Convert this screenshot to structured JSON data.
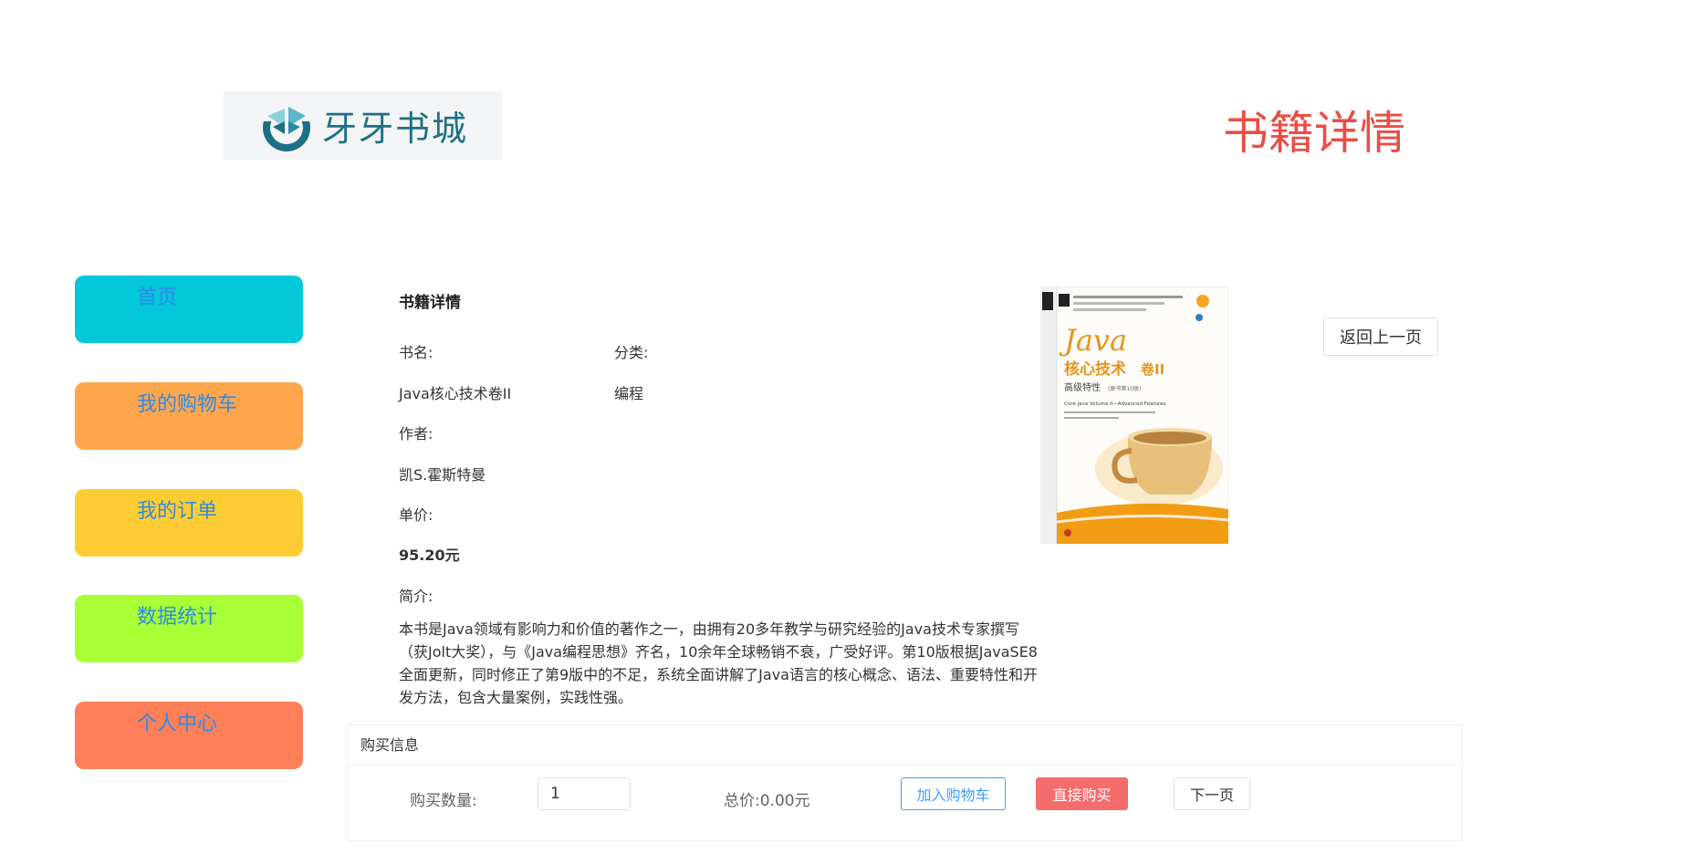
{
  "brand": {
    "logo_text": "牙牙书城"
  },
  "header": {
    "title": "书籍详情"
  },
  "nav": {
    "items": [
      {
        "label": "首页",
        "color": "#04c7da"
      },
      {
        "label": "我的购物车",
        "color": "#ffa64d"
      },
      {
        "label": "我的订单",
        "color": "#ffcc33"
      },
      {
        "label": "数据统计",
        "color": "#a8ff33"
      },
      {
        "label": "个人中心",
        "color": "#ff7f59"
      }
    ]
  },
  "book": {
    "section_title": "书籍详情",
    "name_label": "书名:",
    "name": "Java核心技术卷II",
    "category_label": "分类:",
    "category": "编程",
    "author_label": "作者:",
    "author": "凯S.霍斯特曼",
    "price_label": "单价:",
    "price": "95.20元",
    "intro_label": "简介:",
    "intro": "本书是Java领域有影响力和价值的著作之一，由拥有20多年教学与研究经验的Java技术专家撰写（获Jolt大奖），与《Java编程思想》齐名，10余年全球畅销不衰，广受好评。第10版根据JavaSE8全面更新，同时修正了第9版中的不足，系统全面讲解了Java语言的核心概念、语法、重要特性和开发方法，包含大量案例，实践性强。"
  },
  "cover": {
    "title_java": "Java",
    "title_cn": "核心技术",
    "volume": "卷II",
    "subtitle": "高级特性",
    "edition": "(原书第10版)",
    "english": "Core Java Volume II—Advanced Features"
  },
  "actions": {
    "back_label": "返回上一页"
  },
  "purchase": {
    "header": "购买信息",
    "qty_label": "购买数量:",
    "qty_value": "1",
    "total_label": "总价:",
    "total_value": "0.00元",
    "add_cart_label": "加入购物车",
    "buy_now_label": "直接购买",
    "next_label": "下一页"
  }
}
